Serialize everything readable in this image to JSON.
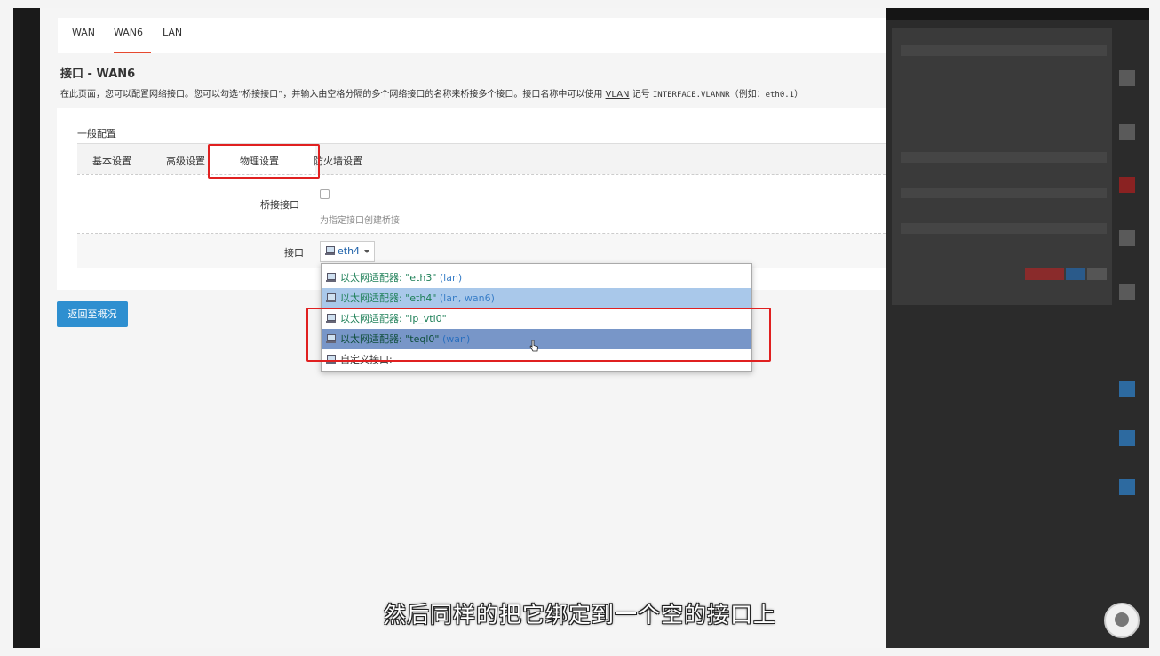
{
  "tabs": [
    "WAN",
    "WAN6",
    "LAN"
  ],
  "active_tab": "WAN6",
  "page_title": "接口 - WAN6",
  "description": {
    "before_vlan": "在此页面，您可以配置网络接口。您可以勾选“桥接接口”，并输入由空格分隔的多个网络接口的名称来桥接多个接口。接口名称中可以使用 ",
    "vlan": "VLAN",
    "after_vlan": " 记号 ",
    "code1": "INTERFACE.VLANNR",
    "middle": "（例如：",
    "code2": "eth0.1",
    "end": "）"
  },
  "section_title": "一般配置",
  "subtabs": [
    "基本设置",
    "高级设置",
    "物理设置",
    "防火墙设置"
  ],
  "active_subtab": "物理设置",
  "bridge": {
    "label": "桥接接口",
    "checked": false,
    "hint": "为指定接口创建桥接"
  },
  "interface": {
    "label": "接口",
    "selected": "eth4"
  },
  "dropdown": [
    {
      "text": "以太网适配器: \"eth3\"",
      "tag": "(lan)",
      "state": "normal"
    },
    {
      "text": "以太网适配器: \"eth4\"",
      "tag": "(lan, wan6)",
      "state": "selected"
    },
    {
      "text": "以太网适配器: \"ip_vti0\"",
      "tag": "",
      "state": "normal"
    },
    {
      "text": "以太网适配器: \"teql0\"",
      "tag": "(wan)",
      "state": "hover"
    },
    {
      "text": "自定义接口:",
      "tag": "",
      "state": "custom"
    }
  ],
  "back_button": "返回至概况",
  "subtitle": "然后同样的把它绑定到一个空的接口上",
  "colors": {
    "accent": "#e6492f",
    "highlight_box": "#e02020",
    "button": "#2e8fd0",
    "selected_row": "#a9c8ea",
    "hover_row": "#7896c8",
    "adapter_text": "#1d7f57"
  },
  "icons": [
    "ethernet-adapter-icon",
    "caret-down-icon",
    "hand-cursor-icon",
    "checkbox-icon"
  ]
}
